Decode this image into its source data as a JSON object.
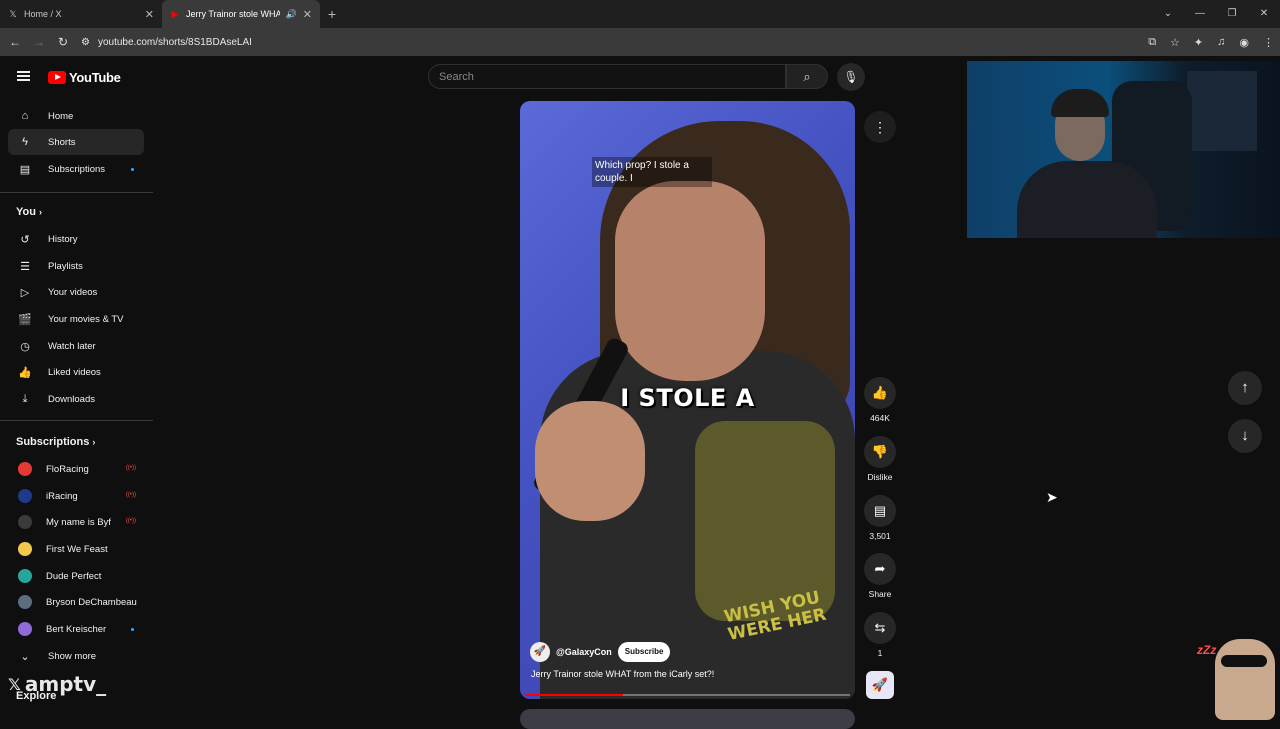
{
  "browser": {
    "tabs": [
      {
        "title": "Home / X",
        "favicon": "x-logo-icon"
      },
      {
        "title": "Jerry Trainor stole WHAT fro",
        "favicon": "youtube-icon"
      }
    ],
    "url": "youtube.com/shorts/8S1BDAseLAI"
  },
  "youtube": {
    "logo_text": "YouTube",
    "search_placeholder": "Search",
    "sidebar": {
      "main": [
        {
          "label": "Home",
          "icon": "home-icon"
        },
        {
          "label": "Shorts",
          "icon": "shorts-icon"
        },
        {
          "label": "Subscriptions",
          "icon": "subscriptions-icon"
        }
      ],
      "you_title": "You",
      "you": [
        {
          "label": "History",
          "icon": "history-icon"
        },
        {
          "label": "Playlists",
          "icon": "playlists-icon"
        },
        {
          "label": "Your videos",
          "icon": "your-videos-icon"
        },
        {
          "label": "Your movies & TV",
          "icon": "movies-icon"
        },
        {
          "label": "Watch later",
          "icon": "watch-later-icon"
        },
        {
          "label": "Liked videos",
          "icon": "liked-icon"
        },
        {
          "label": "Downloads",
          "icon": "download-icon"
        }
      ],
      "subscriptions_title": "Subscriptions",
      "subscriptions": [
        {
          "label": "FloRacing",
          "color": "#e53935",
          "live": true
        },
        {
          "label": "iRacing",
          "color": "#1e3a8a",
          "live": true
        },
        {
          "label": "My name is Byf",
          "color": "#3b3b3b",
          "live": true
        },
        {
          "label": "First We Feast",
          "color": "#f2c94c",
          "live": false
        },
        {
          "label": "Dude Perfect",
          "color": "#26a69a",
          "live": false
        },
        {
          "label": "Bryson DeChambeau",
          "color": "#5d6d7e",
          "live": false
        },
        {
          "label": "Bert Kreischer",
          "color": "#8e6bd6",
          "live": false
        }
      ],
      "show_more": "Show more",
      "explore": "Explore"
    },
    "short": {
      "caption_top": "Which prop? I stole a couple. I",
      "caption_big": "I STOLE A",
      "shirt_text": "WISH YOU WERE HER",
      "channel": "@GalaxyCon",
      "subscribe": "Subscribe",
      "title": "Jerry Trainor stole WHAT from the iCarly set?!",
      "progress": 0.3
    },
    "actions": {
      "likes": "464K",
      "dislike": "Dislike",
      "comments": "3,501",
      "share": "Share",
      "remix": "1"
    }
  },
  "overlay": {
    "watermark": "amptv_"
  }
}
